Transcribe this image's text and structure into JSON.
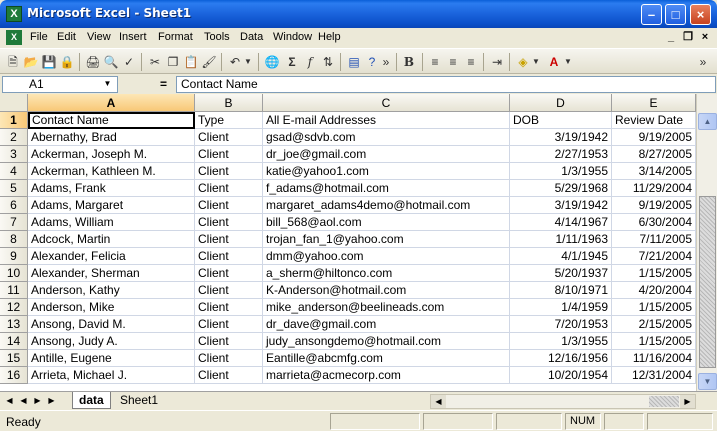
{
  "window": {
    "title": "Microsoft Excel - Sheet1",
    "app_icon_letter": "X"
  },
  "menu": [
    "File",
    "Edit",
    "View",
    "Insert",
    "Format",
    "Tools",
    "Data",
    "Window",
    "Help"
  ],
  "formula_bar": {
    "name_box": "A1",
    "equals": "=",
    "content": "Contact Name"
  },
  "columns": [
    "A",
    "B",
    "C",
    "D",
    "E"
  ],
  "rows": [
    {
      "n": "1",
      "a": "Contact Name",
      "b": "Type",
      "c": "All E-mail Addresses",
      "d": "DOB",
      "e": "Review Date"
    },
    {
      "n": "2",
      "a": "Abernathy, Brad",
      "b": "Client",
      "c": "gsad@sdvb.com",
      "d": "3/19/1942",
      "e": "9/19/2005"
    },
    {
      "n": "3",
      "a": "Ackerman, Joseph M.",
      "b": "Client",
      "c": "dr_joe@gmail.com",
      "d": "2/27/1953",
      "e": "8/27/2005"
    },
    {
      "n": "4",
      "a": "Ackerman, Kathleen M.",
      "b": "Client",
      "c": "katie@yahoo1.com",
      "d": "1/3/1955",
      "e": "3/14/2005"
    },
    {
      "n": "5",
      "a": "Adams, Frank",
      "b": "Client",
      "c": "f_adams@hotmail.com",
      "d": "5/29/1968",
      "e": "11/29/2004"
    },
    {
      "n": "6",
      "a": "Adams, Margaret",
      "b": "Client",
      "c": "margaret_adams4demo@hotmail.com",
      "d": "3/19/1942",
      "e": "9/19/2005"
    },
    {
      "n": "7",
      "a": "Adams, William",
      "b": "Client",
      "c": "bill_568@aol.com",
      "d": "4/14/1967",
      "e": "6/30/2004"
    },
    {
      "n": "8",
      "a": "Adcock, Martin",
      "b": "Client",
      "c": "trojan_fan_1@yahoo.com",
      "d": "1/11/1963",
      "e": "7/11/2005"
    },
    {
      "n": "9",
      "a": "Alexander, Felicia",
      "b": "Client",
      "c": "dmm@yahoo.com",
      "d": "4/1/1945",
      "e": "7/21/2004"
    },
    {
      "n": "10",
      "a": "Alexander, Sherman",
      "b": "Client",
      "c": "a_sherm@hiltonco.com",
      "d": "5/20/1937",
      "e": "1/15/2005"
    },
    {
      "n": "11",
      "a": "Anderson, Kathy",
      "b": "Client",
      "c": "K-Anderson@hotmail.com",
      "d": "8/10/1971",
      "e": "4/20/2004"
    },
    {
      "n": "12",
      "a": "Anderson, Mike",
      "b": "Client",
      "c": "mike_anderson@beelineads.com",
      "d": "1/4/1959",
      "e": "1/15/2005"
    },
    {
      "n": "13",
      "a": "Ansong, David M.",
      "b": "Client",
      "c": "dr_dave@gmail.com",
      "d": "7/20/1953",
      "e": "2/15/2005"
    },
    {
      "n": "14",
      "a": "Ansong, Judy A.",
      "b": "Client",
      "c": "judy_ansongdemo@hotmail.com",
      "d": "1/3/1955",
      "e": "1/15/2005"
    },
    {
      "n": "15",
      "a": "Antille, Eugene",
      "b": "Client",
      "c": "Eantille@abcmfg.com",
      "d": "12/16/1956",
      "e": "11/16/2004"
    },
    {
      "n": "16",
      "a": "Arrieta, Michael J.",
      "b": "Client",
      "c": "marrieta@acmecorp.com",
      "d": "10/20/1954",
      "e": "12/31/2004"
    }
  ],
  "sheets": {
    "active": "data",
    "other": "Sheet1"
  },
  "status": {
    "text": "Ready",
    "num": "NUM"
  },
  "colors": {
    "title_bar": "#0a5fd8",
    "selected_header": "#f8c877"
  }
}
